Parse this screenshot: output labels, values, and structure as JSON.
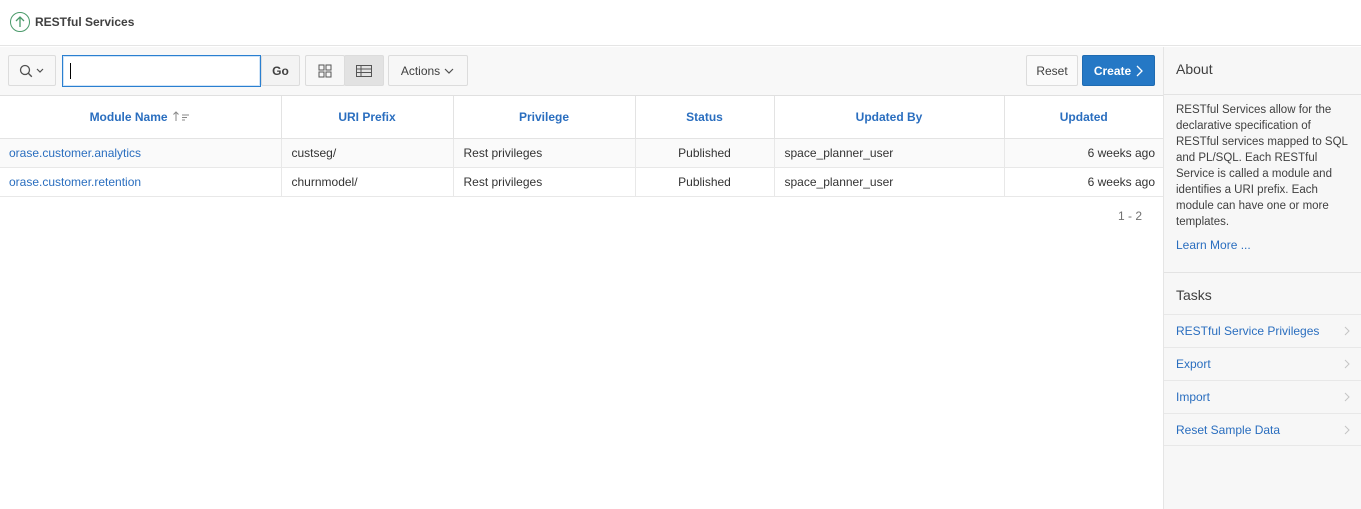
{
  "header": {
    "title": "RESTful Services"
  },
  "toolbar": {
    "search_value": "",
    "go_label": "Go",
    "actions_label": "Actions",
    "reset_label": "Reset",
    "create_label": "Create"
  },
  "report": {
    "columns": [
      "Module Name",
      "URI Prefix",
      "Privilege",
      "Status",
      "Updated By",
      "Updated"
    ],
    "sort_column": "Module Name",
    "rows": [
      {
        "module": "orase.customer.analytics",
        "uri": "custseg/",
        "privilege": "Rest privileges",
        "status": "Published",
        "updated_by": "space_planner_user",
        "updated": "6 weeks ago"
      },
      {
        "module": "orase.customer.retention",
        "uri": "churnmodel/",
        "privilege": "Rest privileges",
        "status": "Published",
        "updated_by": "space_planner_user",
        "updated": "6 weeks ago"
      }
    ],
    "pagination": "1 - 2"
  },
  "about": {
    "title": "About",
    "text": "RESTful Services allow for the declarative specification of RESTful services mapped to SQL and PL/SQL. Each RESTful Service is called a module and identifies a URI prefix. Each module can have one or more templates.",
    "learn_more": "Learn More ..."
  },
  "tasks": {
    "title": "Tasks",
    "items": [
      "RESTful Service Privileges",
      "Export",
      "Import",
      "Reset Sample Data"
    ]
  },
  "colors": {
    "accent": "#2a6ebf",
    "create_button": "#2578c5",
    "up_icon": "#4a9a6a"
  }
}
